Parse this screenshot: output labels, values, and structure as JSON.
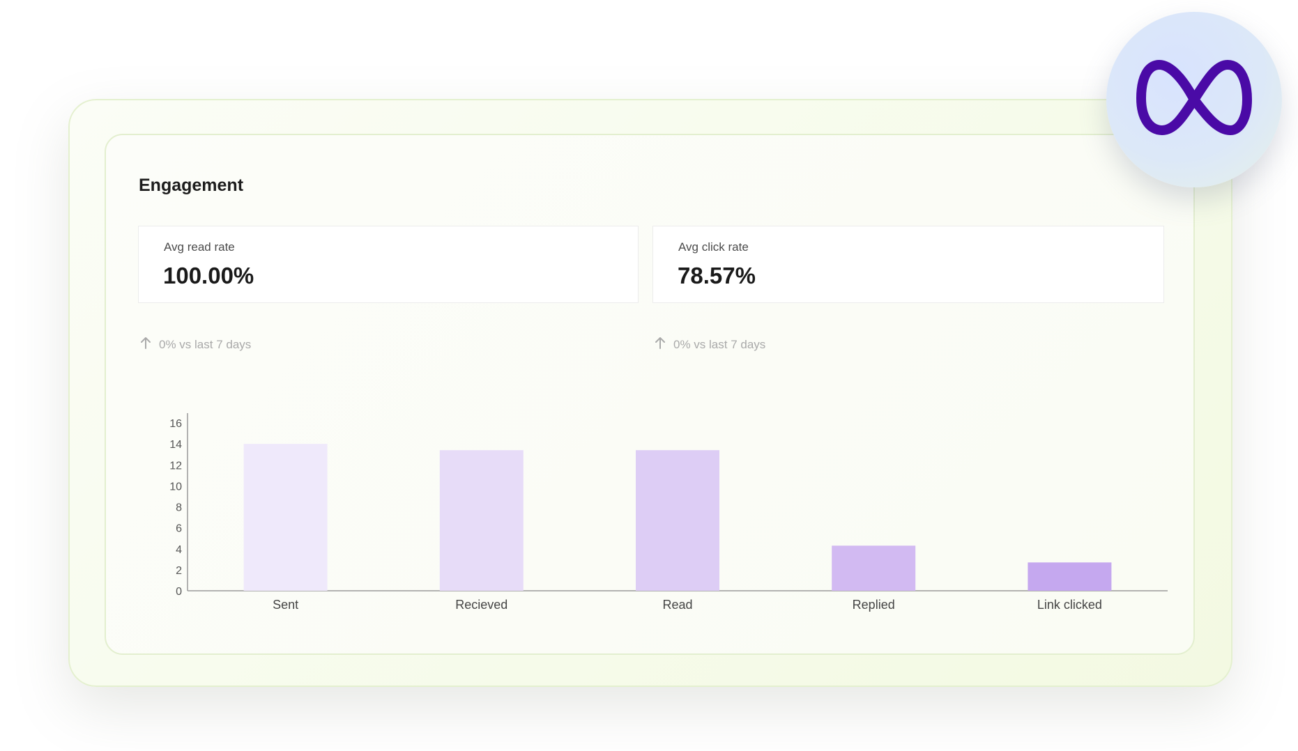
{
  "title": "Engagement",
  "stats": [
    {
      "label": "Avg read rate",
      "value": "100.00%",
      "trend": "0% vs last 7 days"
    },
    {
      "label": "Avg click rate",
      "value": "78.57%",
      "trend": "0% vs last 7 days"
    }
  ],
  "icons": {
    "trend": "arrow-up-icon",
    "brand": "meta-logo-icon"
  },
  "colors": {
    "brand": "#4a0aa6",
    "bars": [
      "#efe9fb",
      "#e7dcf8",
      "#ddcdf5",
      "#d2baf2",
      "#c5a8ef"
    ]
  },
  "chart_data": {
    "type": "bar",
    "categories": [
      "Sent",
      "Recieved",
      "Read",
      "Replied",
      "Link clicked"
    ],
    "values": [
      14,
      13.4,
      13.4,
      4.3,
      2.7
    ],
    "yticks": [
      "0",
      "2",
      "4",
      "6",
      "8",
      "10",
      "12",
      "14",
      "16"
    ],
    "ylim": [
      0,
      16.8
    ],
    "grid": false,
    "legend": "none"
  }
}
